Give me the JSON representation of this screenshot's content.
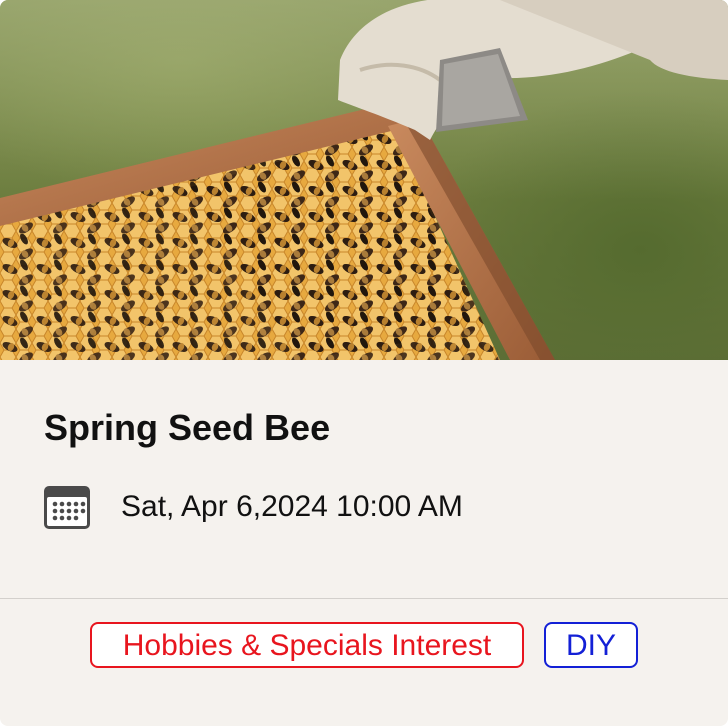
{
  "event": {
    "image_alt": "Beekeeper holding a honeycomb frame covered with bees",
    "title": "Spring Seed Bee",
    "date_icon": "calendar-icon",
    "datetime": "Sat, Apr 6,2024 10:00 AM"
  },
  "tags": [
    {
      "label": "Hobbies & Specials Interest",
      "color": "#e8151e"
    },
    {
      "label": "DIY",
      "color": "#1320d6"
    }
  ],
  "colors": {
    "card_background": "#f5f2ee",
    "divider": "#d3d0cc"
  }
}
